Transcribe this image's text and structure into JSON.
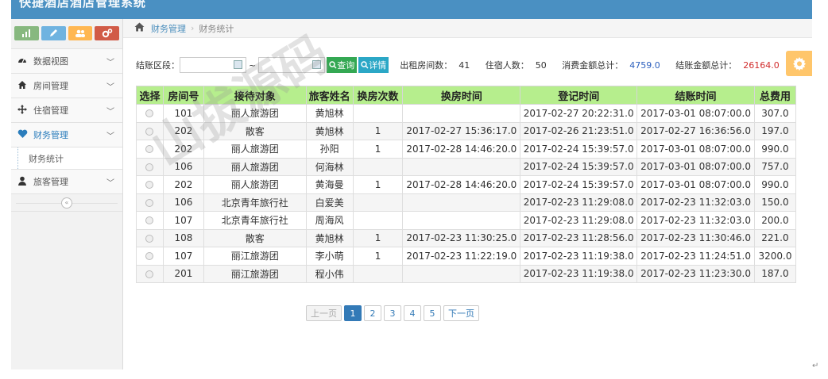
{
  "app": {
    "title": "快捷酒店酒店管理系统"
  },
  "sidebar": {
    "quick_icons": [
      "bar-chart-icon",
      "pencil-icon",
      "users-icon",
      "cogs-icon"
    ],
    "items": [
      {
        "label": "数据视图",
        "icon": "dashboard-icon",
        "chevron": "﹀"
      },
      {
        "label": "房间管理",
        "icon": "home-icon",
        "chevron": "﹀"
      },
      {
        "label": "住宿管理",
        "icon": "move-icon",
        "chevron": "﹀"
      },
      {
        "label": "财务管理",
        "icon": "heart-icon",
        "chevron": "﹀"
      },
      {
        "label": "旅客管理",
        "icon": "user-icon",
        "chevron": "﹀"
      }
    ],
    "sub_item": "财务统计",
    "collapse": "«"
  },
  "breadcrumb": {
    "level1": "财务管理",
    "sep": "›",
    "level2": "财务统计"
  },
  "filter": {
    "label": "结账区段：",
    "start_value": "",
    "end_value": "",
    "tilde": "~",
    "query_btn": "查询",
    "detail_btn": "详情"
  },
  "stats": {
    "rooms_label": "出租房间数：",
    "rooms": "41",
    "guests_label": "住宿人数：",
    "guests": "50",
    "consume_label": "消费金额总计：",
    "consume": "4759.0",
    "checkout_label": "结账金额总计：",
    "checkout": "26164.0"
  },
  "colors": {
    "accent": "#4a90c2",
    "header_green": "#b6ee8d",
    "query_green": "#34a853",
    "detail_teal": "#2ba7c6",
    "gear_orange": "#ffc66b",
    "total_red": "#d12c2c"
  },
  "table": {
    "columns": [
      "选择",
      "房间号",
      "接待对象",
      "旅客姓名",
      "换房次数",
      "换房时间",
      "登记时间",
      "结账时间",
      "总费用"
    ],
    "rows": [
      [
        "",
        "101",
        "丽人旅游团",
        "黄旭林",
        "",
        "",
        "2017-02-27 20:22:31.0",
        "2017-03-01 08:07:00.0",
        "307.0"
      ],
      [
        "",
        "202",
        "散客",
        "黄旭林",
        "1",
        "2017-02-27 15:36:17.0",
        "2017-02-26 21:23:51.0",
        "2017-02-27 16:36:56.0",
        "197.0"
      ],
      [
        "",
        "202",
        "丽人旅游团",
        "孙阳",
        "1",
        "2017-02-28 14:46:20.0",
        "2017-02-24 15:39:57.0",
        "2017-03-01 08:07:00.0",
        "990.0"
      ],
      [
        "",
        "106",
        "丽人旅游团",
        "何海林",
        "",
        "",
        "2017-02-24 15:39:57.0",
        "2017-03-01 08:07:00.0",
        "757.0"
      ],
      [
        "",
        "202",
        "丽人旅游团",
        "黄海曼",
        "1",
        "2017-02-28 14:46:20.0",
        "2017-02-24 15:39:57.0",
        "2017-03-01 08:07:00.0",
        "990.0"
      ],
      [
        "",
        "106",
        "北京青年旅行社",
        "白爱美",
        "",
        "",
        "2017-02-23 11:29:08.0",
        "2017-02-23 11:32:03.0",
        "150.0"
      ],
      [
        "",
        "107",
        "北京青年旅行社",
        "周海风",
        "",
        "",
        "2017-02-23 11:29:08.0",
        "2017-02-23 11:32:03.0",
        "200.0"
      ],
      [
        "",
        "108",
        "散客",
        "黄旭林",
        "1",
        "2017-02-23 11:30:25.0",
        "2017-02-23 11:28:56.0",
        "2017-02-23 11:30:46.0",
        "221.0"
      ],
      [
        "",
        "107",
        "丽江旅游团",
        "李小萌",
        "1",
        "2017-02-23 11:22:19.0",
        "2017-02-23 11:19:38.0",
        "2017-02-23 11:24:51.0",
        "3200.0"
      ],
      [
        "",
        "201",
        "丽江旅游团",
        "程小伟",
        "",
        "",
        "2017-02-23 11:19:38.0",
        "2017-02-23 11:23:30.0",
        "187.0"
      ]
    ]
  },
  "pager": {
    "prev": "上一页",
    "pages": [
      "1",
      "2",
      "3",
      "4",
      "5"
    ],
    "current": "1",
    "next": "下一页"
  },
  "watermark": "山拔源码",
  "return_mark": "↵"
}
